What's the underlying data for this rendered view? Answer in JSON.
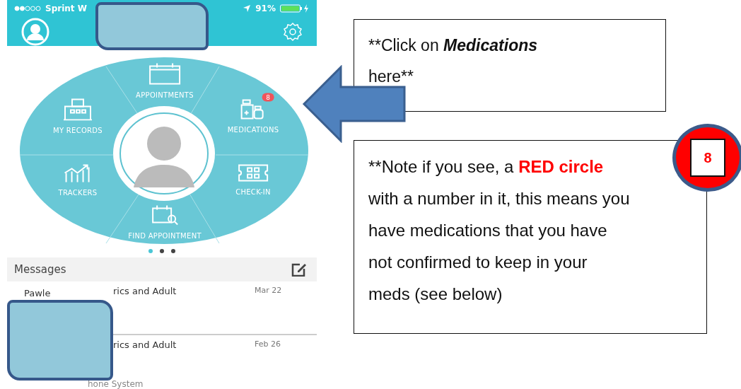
{
  "status_bar": {
    "carrier": "Sprint W",
    "battery": "91%"
  },
  "menu": [
    {
      "label": "APPOINTMENTS",
      "kind": "calendar"
    },
    {
      "label": "MEDICATIONS",
      "kind": "medication",
      "badge": "8"
    },
    {
      "label": "CHECK-IN",
      "kind": "checkin"
    },
    {
      "label": "FIND APPOINTMENT",
      "kind": "find"
    },
    {
      "label": "TRACKERS",
      "kind": "trackers"
    },
    {
      "label": "MY RECORDS",
      "kind": "records"
    }
  ],
  "page_dots": [
    {
      "selected": true
    },
    {
      "selected": false
    },
    {
      "selected": false
    }
  ],
  "messages": {
    "title": "Messages",
    "rows": [
      {
        "sender_start": "Pawle",
        "sender_end": "rics and Adult",
        "date": "Mar 22"
      },
      {
        "sender_end": "rics and Adult",
        "date": "Feb 26",
        "preview": "hone System"
      }
    ]
  },
  "callouts": [
    {
      "kind": "instruction",
      "parts": [
        {
          "text": "**Click on ",
          "kind": "plain"
        },
        {
          "text": "Medications",
          "kind": "emphasis"
        },
        {
          "text": " here**",
          "kind": "plain"
        }
      ]
    },
    {
      "kind": "note",
      "badge": "8",
      "parts": [
        {
          "text": "**Note if you see, a ",
          "kind": "plain"
        },
        {
          "text": "RED circle",
          "kind": "alert"
        },
        {
          "text": " with a number in it, this means you have medications that you have not confirmed to keep in your meds (see below)",
          "kind": "plain"
        }
      ]
    }
  ]
}
